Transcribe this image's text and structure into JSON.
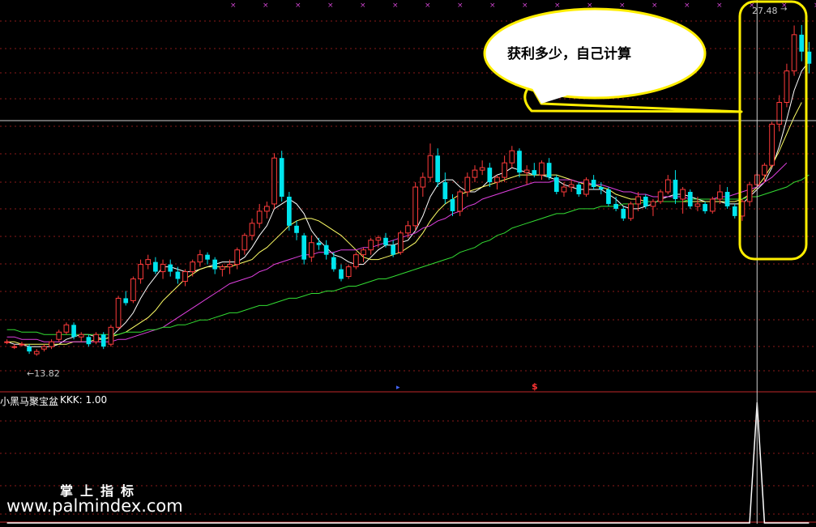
{
  "indicator": {
    "name": "小黑马聚宝盆",
    "value_text": "KKK: 1.00"
  },
  "annotation": {
    "bubble_text": "获利多少，自己计算"
  },
  "price_labels": {
    "high": "27.48",
    "low": "←13.82"
  },
  "watermark": {
    "line1": "掌上指标",
    "line2": "www.palmindex.com"
  },
  "colors": {
    "background": "#000000",
    "up": "#ff3b3b",
    "down": "#00e5ee",
    "ma5": "#ffffff",
    "ma10": "#ffff66",
    "ma20": "#e040e0",
    "ma60": "#33dd33",
    "grid": "#8b1a1a",
    "highlight": "#ffee00"
  },
  "chart_data": {
    "type": "candlestick",
    "ylim": [
      12.8,
      28.2
    ],
    "candles": [
      [
        14.4,
        14.5,
        14.3,
        14.4
      ],
      [
        14.2,
        14.3,
        14.1,
        14.2
      ],
      [
        14.3,
        14.4,
        14.2,
        14.3
      ],
      [
        14.2,
        14.3,
        13.9,
        14.0
      ],
      [
        13.9,
        14.1,
        13.82,
        14.0
      ],
      [
        14.1,
        14.3,
        14.0,
        14.2
      ],
      [
        14.2,
        14.5,
        14.1,
        14.4
      ],
      [
        14.5,
        14.9,
        14.4,
        14.8
      ],
      [
        14.8,
        15.2,
        14.7,
        15.1
      ],
      [
        15.1,
        15.2,
        14.5,
        14.6
      ],
      [
        14.6,
        14.8,
        14.4,
        14.7
      ],
      [
        14.6,
        14.7,
        14.2,
        14.3
      ],
      [
        14.4,
        14.8,
        14.3,
        14.7
      ],
      [
        14.7,
        14.8,
        14.1,
        14.2
      ],
      [
        14.3,
        15.1,
        14.2,
        15.0
      ],
      [
        15.0,
        16.3,
        14.9,
        16.2
      ],
      [
        16.2,
        16.5,
        15.9,
        16.0
      ],
      [
        16.1,
        17.1,
        16.0,
        17.0
      ],
      [
        17.0,
        17.8,
        16.8,
        17.6
      ],
      [
        17.6,
        18.0,
        17.4,
        17.8
      ],
      [
        17.7,
        17.9,
        17.2,
        17.3
      ],
      [
        17.3,
        17.8,
        17.0,
        17.6
      ],
      [
        17.6,
        17.8,
        17.1,
        17.3
      ],
      [
        17.3,
        17.5,
        16.8,
        17.0
      ],
      [
        16.9,
        17.4,
        16.7,
        17.3
      ],
      [
        17.3,
        17.8,
        17.1,
        17.7
      ],
      [
        17.7,
        18.2,
        17.5,
        18.0
      ],
      [
        18.0,
        18.1,
        17.6,
        17.8
      ],
      [
        17.8,
        17.9,
        17.2,
        17.4
      ],
      [
        17.4,
        17.6,
        17.1,
        17.5
      ],
      [
        17.5,
        17.8,
        17.2,
        17.6
      ],
      [
        17.6,
        18.3,
        17.4,
        18.2
      ],
      [
        18.2,
        18.9,
        18.0,
        18.8
      ],
      [
        18.8,
        19.5,
        18.6,
        19.3
      ],
      [
        19.3,
        20.1,
        19.1,
        19.8
      ],
      [
        19.8,
        20.2,
        19.5,
        20.0
      ],
      [
        20.1,
        22.2,
        19.9,
        22.0
      ],
      [
        22.0,
        22.3,
        20.2,
        20.4
      ],
      [
        20.4,
        20.6,
        19.0,
        19.2
      ],
      [
        19.2,
        19.4,
        18.6,
        18.9
      ],
      [
        18.8,
        18.9,
        17.6,
        17.8
      ],
      [
        17.9,
        18.8,
        17.7,
        18.5
      ],
      [
        18.5,
        18.7,
        18.2,
        18.4
      ],
      [
        18.4,
        18.6,
        17.8,
        18.0
      ],
      [
        17.9,
        18.1,
        17.3,
        17.4
      ],
      [
        17.4,
        17.6,
        16.9,
        17.0
      ],
      [
        17.1,
        17.6,
        17.0,
        17.5
      ],
      [
        17.5,
        18.1,
        17.4,
        18.0
      ],
      [
        18.0,
        18.3,
        17.7,
        18.2
      ],
      [
        18.2,
        18.7,
        18.0,
        18.6
      ],
      [
        18.6,
        18.8,
        18.3,
        18.7
      ],
      [
        18.7,
        18.9,
        18.3,
        18.4
      ],
      [
        18.4,
        18.6,
        17.9,
        18.0
      ],
      [
        18.1,
        19.0,
        18.0,
        18.9
      ],
      [
        18.9,
        19.4,
        18.7,
        19.2
      ],
      [
        19.2,
        21.0,
        19.0,
        20.8
      ],
      [
        20.8,
        21.4,
        20.4,
        21.2
      ],
      [
        21.2,
        22.6,
        21.0,
        22.1
      ],
      [
        22.1,
        22.4,
        20.8,
        21.0
      ],
      [
        21.0,
        21.4,
        20.1,
        20.3
      ],
      [
        20.3,
        20.5,
        19.6,
        19.8
      ],
      [
        19.8,
        20.7,
        19.6,
        20.6
      ],
      [
        20.6,
        21.4,
        20.4,
        21.2
      ],
      [
        21.2,
        21.7,
        21.0,
        21.5
      ],
      [
        21.5,
        21.9,
        21.3,
        21.6
      ],
      [
        21.6,
        21.8,
        20.8,
        21.0
      ],
      [
        21.0,
        21.3,
        20.7,
        21.2
      ],
      [
        21.2,
        22.1,
        21.0,
        21.8
      ],
      [
        21.8,
        22.5,
        21.6,
        22.3
      ],
      [
        22.3,
        22.4,
        21.2,
        21.4
      ],
      [
        21.4,
        21.7,
        20.9,
        21.5
      ],
      [
        21.5,
        21.8,
        21.2,
        21.3
      ],
      [
        21.3,
        21.9,
        21.1,
        21.8
      ],
      [
        21.8,
        22.0,
        21.1,
        21.2
      ],
      [
        21.2,
        21.3,
        20.5,
        20.6
      ],
      [
        20.6,
        21.0,
        20.4,
        20.8
      ],
      [
        20.8,
        21.1,
        20.6,
        20.9
      ],
      [
        20.9,
        21.0,
        20.4,
        20.5
      ],
      [
        20.5,
        21.2,
        20.4,
        21.1
      ],
      [
        21.1,
        21.3,
        20.7,
        20.8
      ],
      [
        20.8,
        21.0,
        20.5,
        20.7
      ],
      [
        20.7,
        20.8,
        20.0,
        20.1
      ],
      [
        20.1,
        20.4,
        19.8,
        19.9
      ],
      [
        19.9,
        20.0,
        19.4,
        19.5
      ],
      [
        19.5,
        20.2,
        19.4,
        20.1
      ],
      [
        20.1,
        20.6,
        19.8,
        20.4
      ],
      [
        20.4,
        20.5,
        19.9,
        20.0
      ],
      [
        20.0,
        20.3,
        19.6,
        20.2
      ],
      [
        20.2,
        20.7,
        20.1,
        20.6
      ],
      [
        20.6,
        21.3,
        20.5,
        21.1
      ],
      [
        21.1,
        21.5,
        20.1,
        20.3
      ],
      [
        20.3,
        20.8,
        19.7,
        20.7
      ],
      [
        20.6,
        20.7,
        19.9,
        20.0
      ],
      [
        20.0,
        20.4,
        19.8,
        20.1
      ],
      [
        20.1,
        20.2,
        19.7,
        19.8
      ],
      [
        19.8,
        20.4,
        19.7,
        20.3
      ],
      [
        20.3,
        20.9,
        20.1,
        20.6
      ],
      [
        20.6,
        20.8,
        19.9,
        20.0
      ],
      [
        20.0,
        20.1,
        19.5,
        19.6
      ],
      [
        19.6,
        20.3,
        19.4,
        20.2
      ],
      [
        20.2,
        21.0,
        20.0,
        20.9
      ],
      [
        20.9,
        21.5,
        20.7,
        21.3
      ],
      [
        21.3,
        21.8,
        21.0,
        21.7
      ],
      [
        21.7,
        23.5,
        21.6,
        23.4
      ],
      [
        23.4,
        24.6,
        23.1,
        24.3
      ],
      [
        24.3,
        25.9,
        24.1,
        25.6
      ],
      [
        25.6,
        27.48,
        25.4,
        27.1
      ],
      [
        27.1,
        27.5,
        26.0,
        26.4
      ],
      [
        26.4,
        26.8,
        25.5,
        25.9
      ]
    ],
    "ma": [
      {
        "name": "MA5",
        "color": "#ffffff",
        "values": [
          14.4,
          14.3,
          14.3,
          14.2,
          14.2,
          14.2,
          14.2,
          14.3,
          14.5,
          14.6,
          14.7,
          14.7,
          14.6,
          14.5,
          14.6,
          14.9,
          15.2,
          15.6,
          16.2,
          16.7,
          17.1,
          17.5,
          17.5,
          17.4,
          17.3,
          17.3,
          17.4,
          17.5,
          17.6,
          17.7,
          17.7,
          17.7,
          17.9,
          18.3,
          18.8,
          19.2,
          19.9,
          20.1,
          20.3,
          20.1,
          19.7,
          19.0,
          18.6,
          18.3,
          18.0,
          17.9,
          17.7,
          17.6,
          17.6,
          17.9,
          18.2,
          18.4,
          18.4,
          18.5,
          18.6,
          19.0,
          19.6,
          20.4,
          20.9,
          21.1,
          21.1,
          20.8,
          20.6,
          20.6,
          20.8,
          21.1,
          21.3,
          21.4,
          21.6,
          21.5,
          21.4,
          21.3,
          21.3,
          21.2,
          21.1,
          20.9,
          20.8,
          20.7,
          20.7,
          20.7,
          20.7,
          20.5,
          20.3,
          20.0,
          19.9,
          19.9,
          20.0,
          20.1,
          20.3,
          20.4,
          20.5,
          20.5,
          20.4,
          20.3,
          20.2,
          20.2,
          20.2,
          20.1,
          20.1,
          20.1,
          20.4,
          20.7,
          21.0,
          21.6,
          22.5,
          23.6,
          24.8,
          25.6,
          26.0
        ]
      },
      {
        "name": "MA10",
        "color": "#ffff66",
        "values": [
          14.4,
          14.4,
          14.3,
          14.3,
          14.3,
          14.3,
          14.3,
          14.3,
          14.3,
          14.4,
          14.4,
          14.4,
          14.5,
          14.5,
          14.6,
          14.7,
          14.8,
          15.0,
          15.2,
          15.4,
          15.7,
          16.1,
          16.4,
          16.7,
          17.0,
          17.2,
          17.4,
          17.5,
          17.5,
          17.5,
          17.5,
          17.6,
          17.7,
          17.8,
          18.1,
          18.3,
          18.6,
          18.9,
          19.2,
          19.4,
          19.5,
          19.5,
          19.4,
          19.2,
          19.0,
          18.8,
          18.5,
          18.2,
          17.9,
          17.8,
          17.8,
          17.9,
          18.0,
          18.1,
          18.3,
          18.5,
          18.9,
          19.4,
          19.8,
          20.1,
          20.3,
          20.5,
          20.6,
          20.7,
          20.8,
          20.9,
          21.0,
          21.1,
          21.2,
          21.3,
          21.3,
          21.3,
          21.3,
          21.3,
          21.3,
          21.2,
          21.1,
          21.0,
          20.9,
          20.9,
          20.8,
          20.7,
          20.5,
          20.4,
          20.3,
          20.3,
          20.2,
          20.2,
          20.2,
          20.2,
          20.2,
          20.2,
          20.2,
          20.2,
          20.2,
          20.2,
          20.2,
          20.2,
          20.2,
          20.3,
          20.5,
          20.8,
          21.2,
          21.7,
          22.3,
          23.0,
          23.7,
          24.3
        ]
      },
      {
        "name": "MA20",
        "color": "#e040e0",
        "values": [
          14.6,
          14.6,
          14.5,
          14.5,
          14.5,
          14.4,
          14.4,
          14.4,
          14.4,
          14.4,
          14.4,
          14.4,
          14.4,
          14.4,
          14.4,
          14.5,
          14.5,
          14.6,
          14.7,
          14.8,
          14.9,
          15.0,
          15.2,
          15.4,
          15.6,
          15.8,
          16.0,
          16.2,
          16.4,
          16.6,
          16.8,
          16.9,
          17.0,
          17.1,
          17.3,
          17.4,
          17.6,
          17.7,
          17.8,
          17.9,
          18.0,
          18.0,
          18.1,
          18.1,
          18.1,
          18.2,
          18.2,
          18.2,
          18.3,
          18.3,
          18.4,
          18.5,
          18.6,
          18.7,
          18.8,
          18.9,
          19.1,
          19.2,
          19.4,
          19.5,
          19.7,
          19.8,
          20.0,
          20.1,
          20.3,
          20.4,
          20.5,
          20.6,
          20.7,
          20.8,
          20.9,
          21.0,
          21.0,
          21.0,
          21.1,
          21.1,
          21.1,
          21.0,
          21.0,
          20.9,
          20.9,
          20.8,
          20.7,
          20.6,
          20.6,
          20.5,
          20.5,
          20.4,
          20.4,
          20.4,
          20.4,
          20.4,
          20.3,
          20.3,
          20.3,
          20.3,
          20.4,
          20.4,
          20.5,
          20.6,
          20.7,
          20.8,
          21.0,
          21.2,
          21.5,
          21.8
        ]
      },
      {
        "name": "MA60",
        "color": "#33dd33",
        "values": [
          14.9,
          14.9,
          14.8,
          14.8,
          14.8,
          14.7,
          14.7,
          14.7,
          14.7,
          14.7,
          14.7,
          14.7,
          14.7,
          14.7,
          14.7,
          14.7,
          14.8,
          14.8,
          14.8,
          14.9,
          14.9,
          15.0,
          15.0,
          15.1,
          15.1,
          15.2,
          15.3,
          15.3,
          15.4,
          15.5,
          15.6,
          15.6,
          15.7,
          15.8,
          15.9,
          15.9,
          16.0,
          16.1,
          16.2,
          16.2,
          16.3,
          16.4,
          16.4,
          16.5,
          16.5,
          16.6,
          16.7,
          16.7,
          16.8,
          16.9,
          17.0,
          17.0,
          17.1,
          17.2,
          17.3,
          17.4,
          17.5,
          17.6,
          17.7,
          17.8,
          17.9,
          18.1,
          18.2,
          18.3,
          18.5,
          18.6,
          18.8,
          18.9,
          19.1,
          19.2,
          19.3,
          19.4,
          19.5,
          19.6,
          19.7,
          19.7,
          19.8,
          19.9,
          19.9,
          19.9,
          20.0,
          20.0,
          20.0,
          20.1,
          20.1,
          20.1,
          20.2,
          20.2,
          20.2,
          20.2,
          20.2,
          20.2,
          20.3,
          20.3,
          20.3,
          20.3,
          20.3,
          20.3,
          20.3,
          20.3,
          20.4,
          20.4,
          20.5,
          20.6,
          20.7,
          20.8,
          21.0,
          21.1,
          21.3
        ]
      }
    ],
    "indicator_series": {
      "name": "KKK",
      "values": [
        0,
        0,
        0,
        0,
        0,
        0,
        0,
        0,
        0,
        0,
        0,
        0,
        0,
        0,
        0,
        0,
        0,
        0,
        0,
        0,
        0,
        0,
        0,
        0,
        0,
        0,
        0,
        0,
        0,
        0,
        0,
        0,
        0,
        0,
        0,
        0,
        0,
        0,
        0,
        0,
        0,
        0,
        0,
        0,
        0,
        0,
        0,
        0,
        0,
        0,
        0,
        0,
        0,
        0,
        0,
        0,
        0,
        0,
        0,
        0,
        0,
        0,
        0,
        0,
        0,
        0,
        0,
        0,
        0,
        0,
        0,
        0,
        0,
        0,
        0,
        0,
        0,
        0,
        0,
        0,
        0,
        0,
        0,
        0,
        0,
        0,
        0,
        0,
        0,
        0,
        0,
        0,
        0,
        0,
        0,
        0,
        0,
        0,
        0,
        0,
        0,
        1,
        0,
        0,
        0,
        0,
        0,
        0,
        0
      ]
    }
  }
}
